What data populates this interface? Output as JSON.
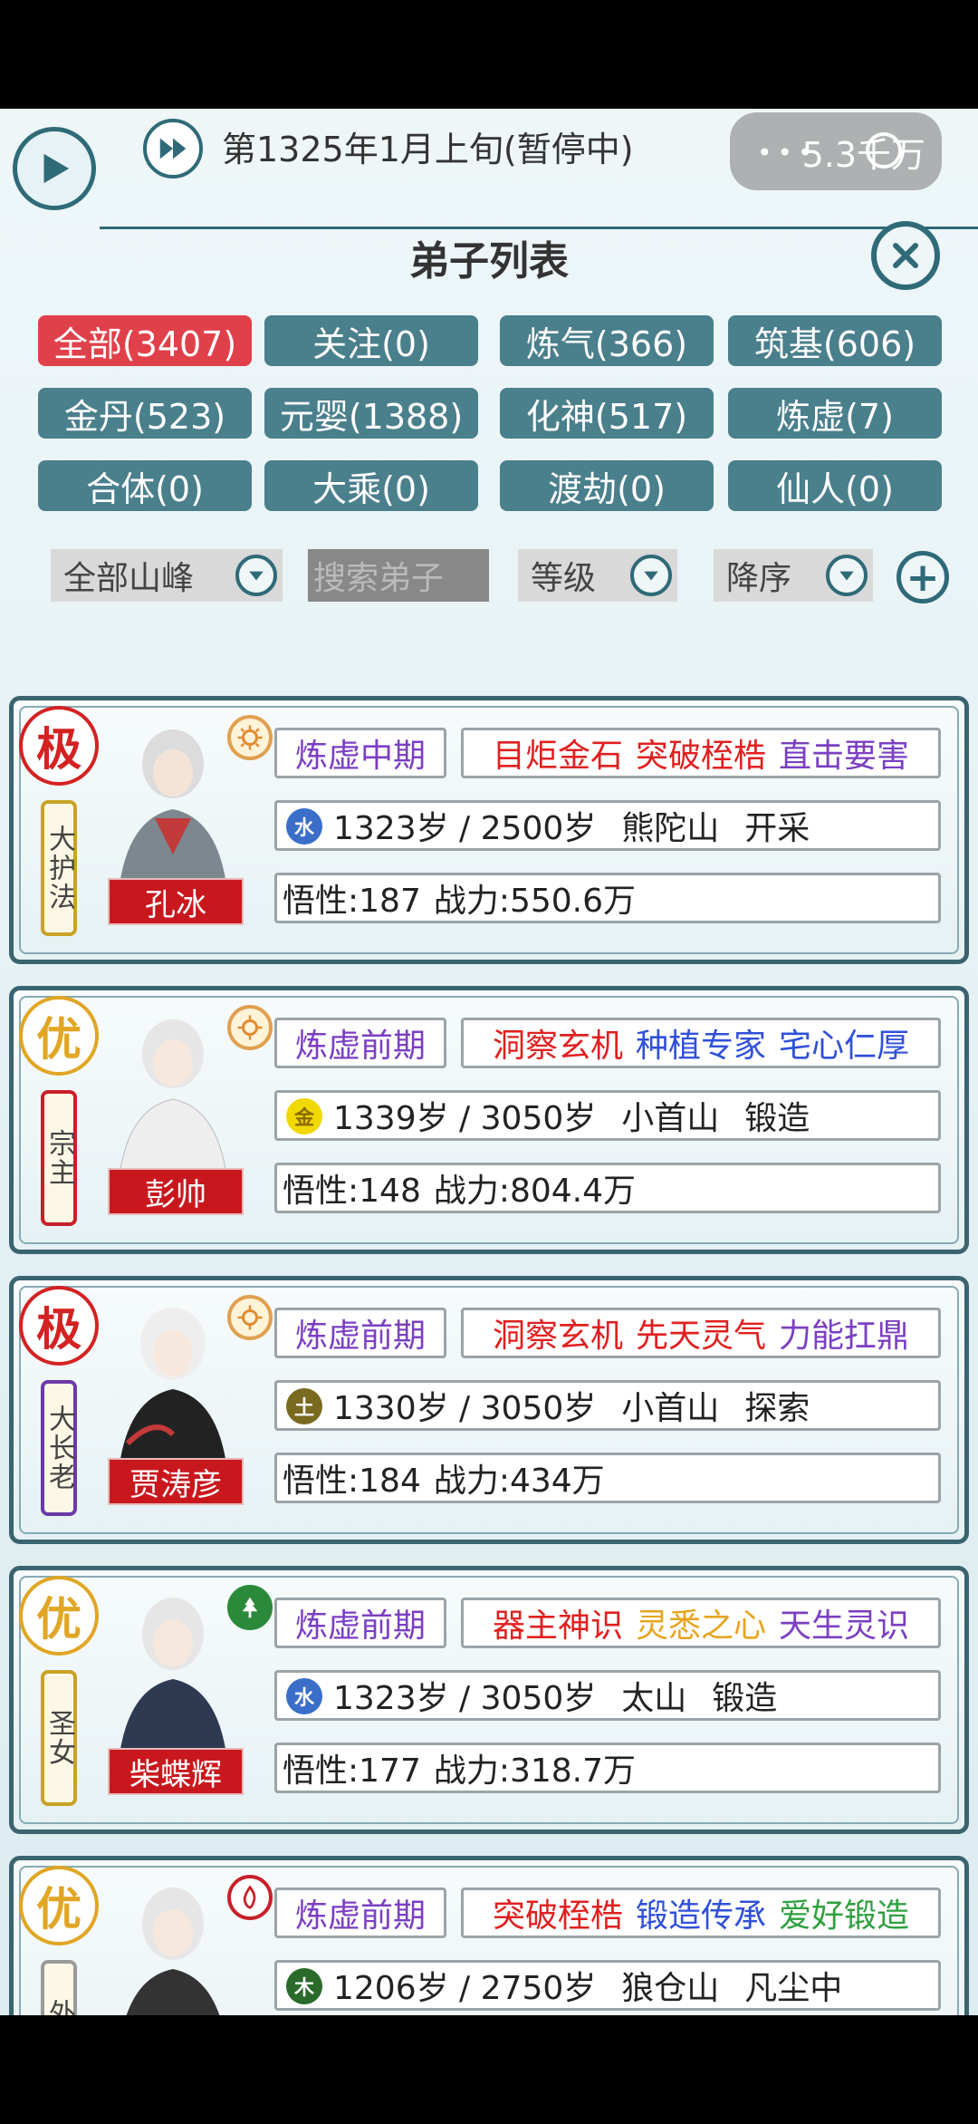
{
  "header": {
    "date": "第1325年1月上旬(暂停中)",
    "money": "5.3千万",
    "title": "弟子列表"
  },
  "tabs": [
    {
      "label": "全部(3407)",
      "active": true
    },
    {
      "label": "关注(0)"
    },
    {
      "label": "炼气(366)"
    },
    {
      "label": "筑基(606)"
    },
    {
      "label": "金丹(523)"
    },
    {
      "label": "元婴(1388)"
    },
    {
      "label": "化神(517)"
    },
    {
      "label": "炼虚(7)"
    },
    {
      "label": "合体(0)"
    },
    {
      "label": "大乘(0)"
    },
    {
      "label": "渡劫(0)"
    },
    {
      "label": "仙人(0)"
    }
  ],
  "filters": {
    "mountain": "全部山峰",
    "search_placeholder": "搜索弟子",
    "sort_field": "等级",
    "sort_order": "降序"
  },
  "disciples": [
    {
      "grade": "极",
      "title": "大护法",
      "name": "孔冰",
      "realm": "炼虚中期",
      "traits": [
        {
          "text": "目炬金石",
          "color": "#e02020"
        },
        {
          "text": "突破桎梏",
          "color": "#e02020"
        },
        {
          "text": "直击要害",
          "color": "#7b3fc2"
        }
      ],
      "element": "水",
      "age": "1323岁 / 2500岁",
      "mountain": "熊陀山",
      "job": "开采",
      "wisdom": "悟性:187",
      "power": "战力:550.6万"
    },
    {
      "grade": "优",
      "title": "宗主",
      "name": "彭帅",
      "realm": "炼虚前期",
      "traits": [
        {
          "text": "洞察玄机",
          "color": "#e02020"
        },
        {
          "text": "种植专家",
          "color": "#3050d8"
        },
        {
          "text": "宅心仁厚",
          "color": "#3050d8"
        }
      ],
      "element": "金",
      "age": "1339岁 / 3050岁",
      "mountain": "小首山",
      "job": "锻造",
      "wisdom": "悟性:148",
      "power": "战力:804.4万"
    },
    {
      "grade": "极",
      "title": "大长老",
      "name": "贾涛彦",
      "realm": "炼虚前期",
      "traits": [
        {
          "text": "洞察玄机",
          "color": "#e02020"
        },
        {
          "text": "先天灵气",
          "color": "#e02020"
        },
        {
          "text": "力能扛鼎",
          "color": "#7b3fc2"
        }
      ],
      "element": "土",
      "age": "1330岁 / 3050岁",
      "mountain": "小首山",
      "job": "探索",
      "wisdom": "悟性:184",
      "power": "战力:434万"
    },
    {
      "grade": "优",
      "title": "圣女",
      "name": "柴蝶辉",
      "realm": "炼虚前期",
      "traits": [
        {
          "text": "器主神识",
          "color": "#e02020"
        },
        {
          "text": "灵悉之心",
          "color": "#e6a520"
        },
        {
          "text": "天生灵识",
          "color": "#7b3fc2"
        }
      ],
      "element": "水",
      "age": "1323岁 / 3050岁",
      "mountain": "太山",
      "job": "锻造",
      "wisdom": "悟性:177",
      "power": "战力:318.7万"
    },
    {
      "grade": "优",
      "title": "外门",
      "name": "",
      "realm": "炼虚前期",
      "traits": [
        {
          "text": "突破桎梏",
          "color": "#e02020"
        },
        {
          "text": "锻造传承",
          "color": "#3050d8"
        },
        {
          "text": "爱好锻造",
          "color": "#30a040"
        }
      ],
      "element": "木",
      "age": "1206岁 / 2750岁",
      "mountain": "狼仓山",
      "job": "凡尘中",
      "wisdom": "",
      "power": ""
    }
  ]
}
